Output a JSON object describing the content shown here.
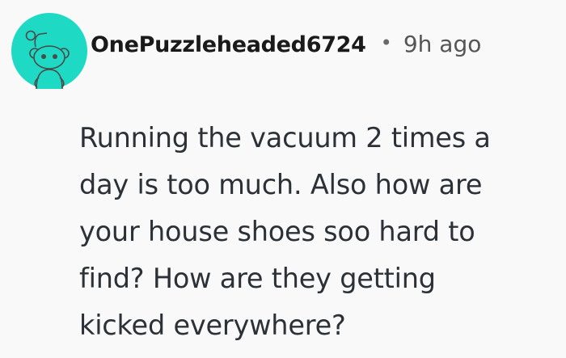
{
  "comment": {
    "avatar_icon": "snoo-avatar-icon",
    "avatar_color": "#1ed9c3",
    "username": "OnePuzzleheaded6724",
    "separator": "•",
    "timestamp": "9h ago",
    "body_lines": [
      "Running the vacuum 2 times a",
      "day is too much. Also how are",
      "your house shoes soo hard to",
      "find? How are they getting",
      "kicked everywhere?"
    ]
  }
}
